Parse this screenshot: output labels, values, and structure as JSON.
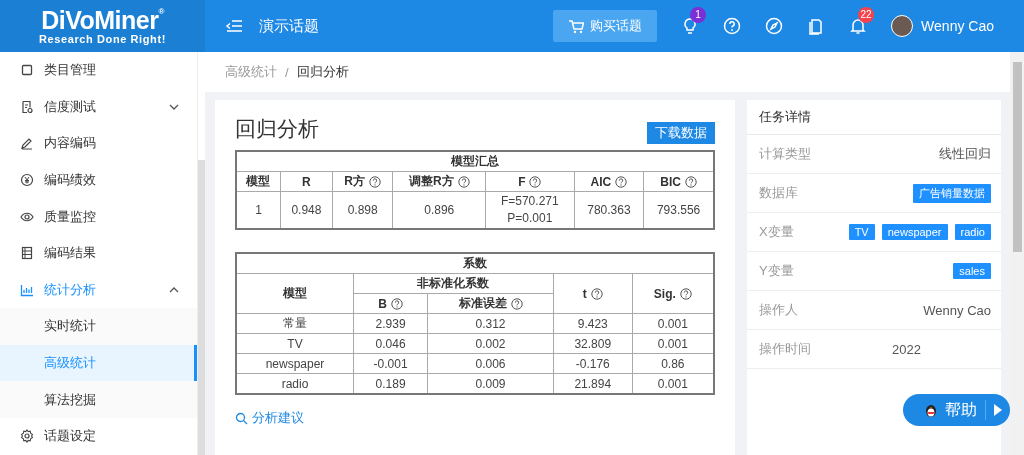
{
  "header": {
    "logo_name": "DiVoMiner",
    "logo_mark": "®",
    "logo_tagline": "Research Done Right!",
    "topic_title": "演示话题",
    "buy_button": "购买话题",
    "tips_badge": "1",
    "notifications_badge": "22",
    "user_name": "Wenny Cao"
  },
  "sidebar": {
    "items": [
      {
        "label": "类目管理",
        "kind": "item",
        "selected": false
      },
      {
        "label": "信度测试",
        "kind": "group",
        "expanded": false
      },
      {
        "label": "内容编码",
        "kind": "item",
        "selected": false
      },
      {
        "label": "编码绩效",
        "kind": "item",
        "selected": false
      },
      {
        "label": "质量监控",
        "kind": "item",
        "selected": false
      },
      {
        "label": "编码结果",
        "kind": "item",
        "selected": false
      },
      {
        "label": "统计分析",
        "kind": "group",
        "expanded": true,
        "children": [
          {
            "label": "实时统计",
            "selected": false
          },
          {
            "label": "高级统计",
            "selected": true
          },
          {
            "label": "算法挖掘",
            "selected": false
          }
        ]
      },
      {
        "label": "话题设定",
        "kind": "item",
        "selected": false
      }
    ]
  },
  "breadcrumb": {
    "items": [
      "高级统计",
      "回归分析"
    ],
    "separator": "/"
  },
  "result": {
    "title": "回归分析",
    "download_button": "下载数据",
    "summary_table": {
      "title": "模型汇总",
      "columns": [
        {
          "label": "模型",
          "help": false
        },
        {
          "label": "R",
          "help": false
        },
        {
          "label": "R方",
          "help": true
        },
        {
          "label": "调整R方",
          "help": true
        },
        {
          "label": "F",
          "help": true
        },
        {
          "label": "AIC",
          "help": true
        },
        {
          "label": "BIC",
          "help": true
        }
      ],
      "rows": [
        [
          "1",
          "0.948",
          "0.898",
          "0.896",
          "F=570.271\nP=0.001",
          "780.363",
          "793.556"
        ]
      ]
    },
    "coefficients_table": {
      "title": "系数",
      "group_header": "非标准化系数",
      "columns": [
        {
          "label": "模型",
          "help": false,
          "grouped": false
        },
        {
          "label": "B",
          "help": true,
          "grouped": true
        },
        {
          "label": "标准误差",
          "help": true,
          "grouped": true
        },
        {
          "label": "t",
          "help": true,
          "grouped": false
        },
        {
          "label": "Sig.",
          "help": true,
          "grouped": false
        }
      ],
      "rows": [
        [
          "常量",
          "2.939",
          "0.312",
          "9.423",
          "0.001"
        ],
        [
          "TV",
          "0.046",
          "0.002",
          "32.809",
          "0.001"
        ],
        [
          "newspaper",
          "-0.001",
          "0.006",
          "-0.176",
          "0.86"
        ],
        [
          "radio",
          "0.189",
          "0.009",
          "21.894",
          "0.001"
        ]
      ]
    },
    "advice_link": "分析建议"
  },
  "details": {
    "title": "任务详情",
    "rows": [
      {
        "label": "计算类型",
        "kind": "text",
        "value": "线性回归"
      },
      {
        "label": "数据库",
        "kind": "tags",
        "tags": [
          "广告销量数据"
        ]
      },
      {
        "label": "X变量",
        "kind": "tags",
        "tags": [
          "TV",
          "newspaper",
          "radio"
        ]
      },
      {
        "label": "Y变量",
        "kind": "tags",
        "tags": [
          "sales"
        ]
      },
      {
        "label": "操作人",
        "kind": "text",
        "value": "Wenny Cao"
      },
      {
        "label": "操作时间",
        "kind": "text",
        "value": "2022"
      }
    ]
  },
  "help_button": {
    "label": "帮助"
  }
}
